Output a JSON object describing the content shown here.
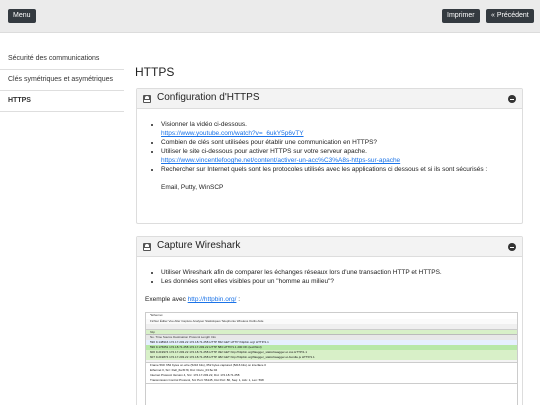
{
  "topbar": {
    "menu_label": "Menu",
    "print_label": "Imprimer",
    "prev_label": "« Précédent"
  },
  "sidebar": {
    "items": [
      {
        "label": "Sécurité des communications"
      },
      {
        "label": "Clés symétriques et asymétriques"
      },
      {
        "label": "HTTPS"
      }
    ]
  },
  "page": {
    "title": "HTTPS"
  },
  "card1": {
    "title": "Configuration d'HTTPS",
    "items": [
      {
        "text": "Visionner la vidéo ci-dessous.",
        "link": "https://www.youtube.com/watch?v=_6ukY5p6vTY"
      },
      {
        "text": "Combien de clés sont utilisées pour établir une communication en HTTPS?"
      },
      {
        "text": "Utiliser le site ci-dessous pour activer HTTPS sur votre serveur apache.",
        "link": "https://www.vincentlefooghe.net/content/activer-un-acc%C3%A8s-https-sur-apache"
      },
      {
        "text": "Rechercher sur Internet quels sont les protocoles utilisés avec les applications ci dessous et si ils sont sécurisés :",
        "extra": "Email, Putty, WinSCP"
      }
    ]
  },
  "card2": {
    "title": "Capture Wireshark",
    "items": [
      {
        "text": "Utiliser Wireshark afin de comparer les échanges réseaux lors d'une transaction HTTP et HTTPS."
      },
      {
        "text": "Les données sont elles visibles pour un \"homme au milieu\"?"
      }
    ],
    "example_prefix": "Exemple avec ",
    "example_link": "http://httpbin.org/",
    "example_suffix": " :"
  },
  "wireshark": {
    "title": "*Ethernet",
    "menu": "Fichier  Éditer  Vue  Aller  Capture  Analyser  Statistiques  Telephonie  Wireless  Outils  Aide",
    "filter": "http",
    "columns": "No.   Time        Source           Destination       Protocol  Length  Info",
    "rows": [
      {
        "text": "590  9.148916   172.17.203.22   172.18.71.258    HTTP   652  GET HTTP /httpbin.org/ HTTP/1.1"
      },
      {
        "text": "596  9.176651   172.18.71.258   172.17.203.22    HTTP   583  HTTP/1.1 200 OK  (text/html)"
      },
      {
        "text": "606  9.219974   172.17.203.22   172.18.71.258    HTTP   492  GET http://httpbin.org/flasgger_static/swagger-ui.css HTTP/1.1"
      },
      {
        "text": "607  9.219874   172.17.203.22   172.18.71.258    HTTP   482  GET http://httpbin.org/flasgger_static/swagger-ui-bundle.js HTTP/1.1"
      }
    ],
    "details": [
      {
        "text": "Frame 590: 652 bytes on wire (5216 bits), 652 bytes captured (5216 bits) on interface 0"
      },
      {
        "text": "Ethernet II, Src: Dell_6a:f0:f9, Dst: Cisco_03:6e:04"
      },
      {
        "text": "Internet Protocol Version 4, Src: 172.17.203.22, Dst: 172.18.71.258"
      },
      {
        "text": "Transmission Control Protocol, Src Port: 56145, Dst Port: 80, Seq: 1, Ack: 1, Len: 598"
      }
    ]
  }
}
